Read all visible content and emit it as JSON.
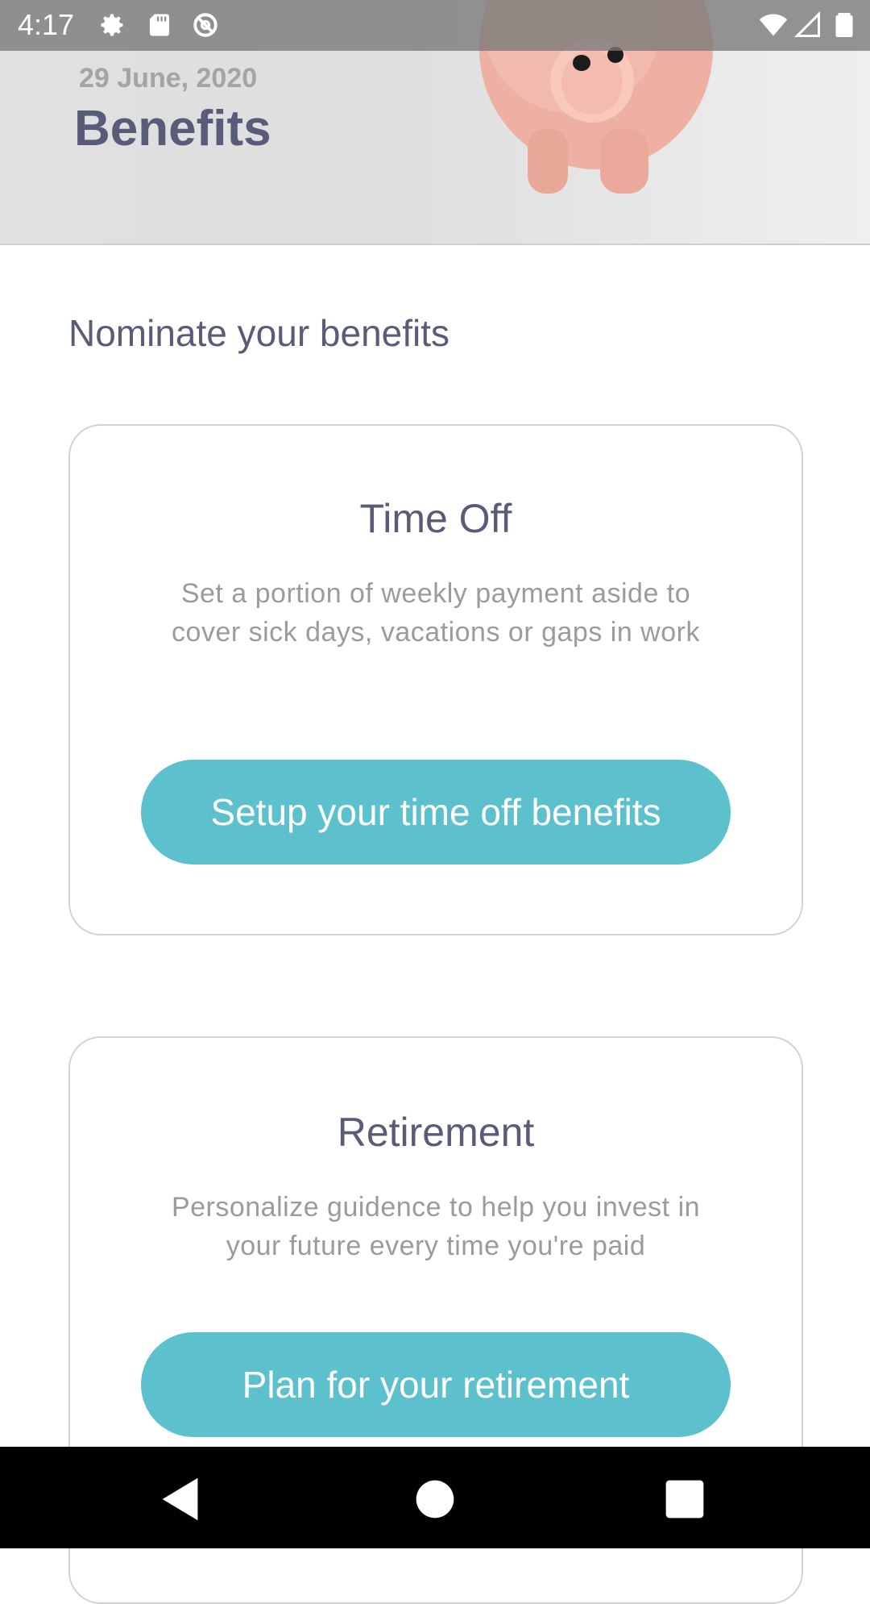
{
  "status_bar": {
    "time": "4:17",
    "icons": [
      "gear-icon",
      "sd-card-icon",
      "sync-icon",
      "wifi-icon",
      "signal-icon",
      "battery-icon"
    ]
  },
  "header": {
    "date": "29 June, 2020",
    "title": "Benefits"
  },
  "section_title": "Nominate your benefits",
  "cards": [
    {
      "title": "Time Off",
      "description": "Set a portion of weekly payment aside to cover sick days, vacations or gaps in work",
      "button_label": "Setup your time off benefits"
    },
    {
      "title": "Retirement",
      "description": "Personalize guidence to help you invest in your future every time you're paid",
      "button_label": "Plan for your retirement"
    }
  ],
  "nav_bar": {
    "buttons": [
      "back-icon",
      "home-icon",
      "recents-icon"
    ]
  },
  "colors": {
    "accent": "#5cc1cd",
    "title_text": "#585c78",
    "muted_text": "#9b9b9b",
    "card_border": "#d2d2d2"
  }
}
